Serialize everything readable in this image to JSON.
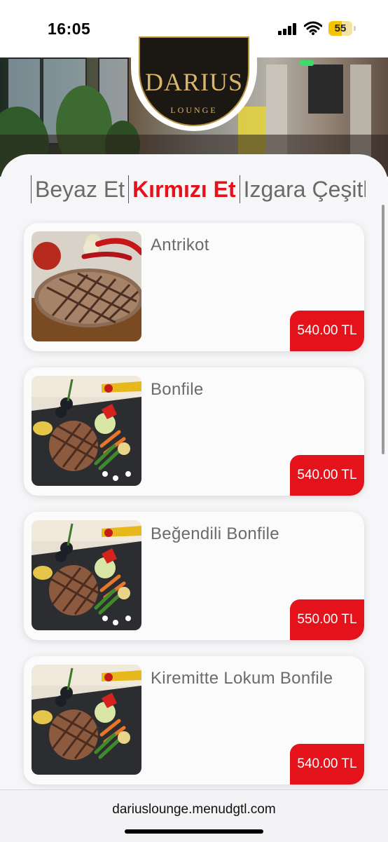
{
  "status_bar": {
    "time": "16:05",
    "battery_level": "55",
    "battery_percent": 55,
    "icons": [
      "signal-icon",
      "wifi-icon",
      "battery-icon"
    ]
  },
  "hero": {
    "logo_title": "DARIUS",
    "logo_subtitle": "LOUNGE"
  },
  "tabs": [
    {
      "label": "Beyaz Et",
      "active": false
    },
    {
      "label": "Kırmızı Et",
      "active": true
    },
    {
      "label": "Izgara Çeşitleri",
      "active": false
    }
  ],
  "menu_items": [
    {
      "name": "Antrikot",
      "price": "540.00 TL",
      "image": "steak-photo"
    },
    {
      "name": "Bonfile",
      "price": "540.00 TL",
      "image": "steak-plate-photo"
    },
    {
      "name": "Beğendili Bonfile",
      "price": "550.00 TL",
      "image": "steak-plate-photo"
    },
    {
      "name": "Kiremitte Lokum Bonfile",
      "price": "540.00 TL",
      "image": "steak-plate-photo"
    }
  ],
  "browser": {
    "url": "dariuslounge.menudgtl.com"
  },
  "colors": {
    "accent": "#e3121b",
    "background": "#f6f6f8",
    "logo_gold": "#d9b66a"
  }
}
